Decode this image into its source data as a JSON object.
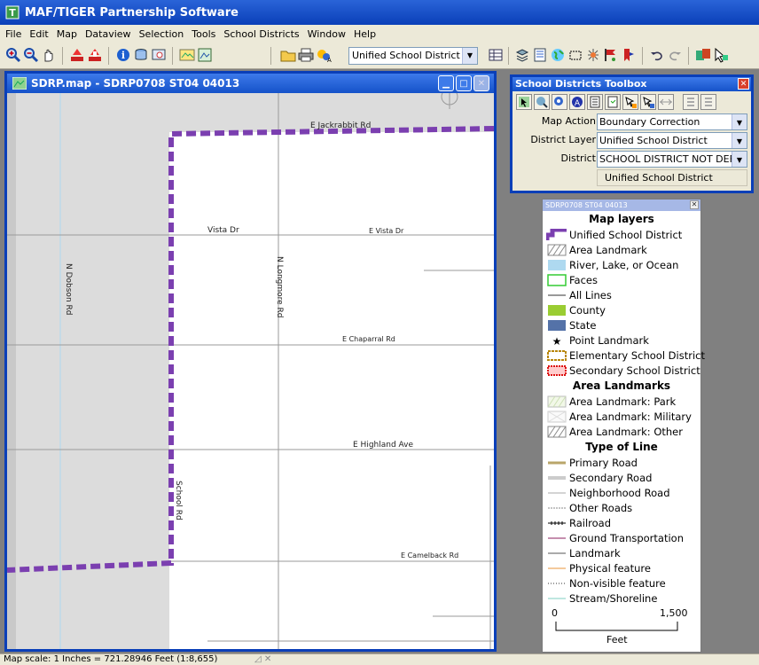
{
  "app": {
    "title": "MAF/TIGER Partnership Software"
  },
  "menu": [
    "File",
    "Edit",
    "Map",
    "Dataview",
    "Selection",
    "Tools",
    "School Districts",
    "Window",
    "Help"
  ],
  "toolbar": {
    "layer_select": "Unified School District"
  },
  "map_window": {
    "title": "SDRP.map - SDRP0708 ST04 04013",
    "road_labels": {
      "jackrabbit": "E Jackrabbit Rd",
      "vista_left": "Vista Dr",
      "vista_right": "E Vista Dr",
      "chaparral": "E Chaparral Rd",
      "highland": "E Highland Ave",
      "camelback": "E Camelback Rd",
      "dobson": "N Dobson Rd",
      "longmore": "N Longmore Rd",
      "school": "School Rd"
    }
  },
  "toolbox": {
    "title": "School Districts Toolbox",
    "map_action_label": "Map Action",
    "map_action_value": "Boundary Correction",
    "district_layer_label": "District Layer",
    "district_layer_value": "Unified School District",
    "district_label": "District",
    "district_value": "SCHOOL DISTRICT NOT DEFI",
    "district_name": "Unified School District"
  },
  "legend": {
    "title": "SDRP0708 ST04 04013",
    "map_layers_heading": "Map layers",
    "map_layers": [
      "Unified School District",
      "Area Landmark",
      "River, Lake, or Ocean",
      "Faces",
      "All Lines",
      "County",
      "State",
      "Point Landmark",
      "Elementary School District",
      "Secondary School District"
    ],
    "area_landmarks_heading": "Area Landmarks",
    "area_landmarks": [
      "Area Landmark: Park",
      "Area Landmark: Military",
      "Area Landmark: Other"
    ],
    "type_of_line_heading": "Type of Line",
    "line_types": [
      "Primary Road",
      "Secondary Road",
      "Neighborhood Road",
      "Other Roads",
      "Railroad",
      "Ground Transportation",
      "Landmark",
      "Physical feature",
      "Non-visible feature",
      "Stream/Shoreline"
    ],
    "scale": {
      "start": "0",
      "end": "1,500",
      "unit": "Feet"
    }
  },
  "status": {
    "scale_text": "Map scale: 1 Inches = 721.28946 Feet (1:8,655)"
  },
  "colors": {
    "boundary": "#7b3fb0",
    "title_blue": "#0a3fb8",
    "county": "#9acd32",
    "state": "#5472a8",
    "water": "#aed9f0"
  }
}
